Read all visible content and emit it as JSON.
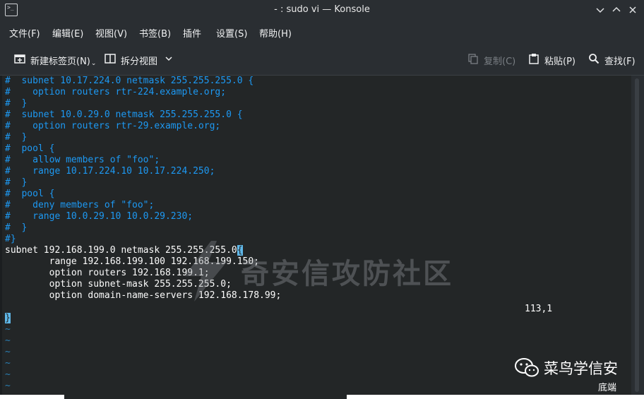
{
  "window": {
    "title": "- : sudo vi — Konsole",
    "app_icon": "terminal-icon",
    "app_icon_glyph": ">_"
  },
  "menubar": {
    "items": [
      {
        "label": "文件(F)"
      },
      {
        "label": "编辑(E)"
      },
      {
        "label": "视图(V)"
      },
      {
        "label": "书签(B)"
      },
      {
        "label": "插件"
      },
      {
        "label": "设置(S)"
      },
      {
        "label": "帮助(H)"
      }
    ]
  },
  "toolbar": {
    "new_tab_label": "新建标签页(N)",
    "split_view_label": "拆分视图",
    "copy_label": "复制(C)",
    "paste_label": "粘贴(P)",
    "find_label": "查找(F)"
  },
  "terminal": {
    "lines": [
      {
        "text": "#  subnet 10.17.224.0 netmask 255.255.255.0 {",
        "kind": "comment"
      },
      {
        "text": "#    option routers rtr-224.example.org;",
        "kind": "comment"
      },
      {
        "text": "#  }",
        "kind": "comment"
      },
      {
        "text": "#  subnet 10.0.29.0 netmask 255.255.255.0 {",
        "kind": "comment"
      },
      {
        "text": "#    option routers rtr-29.example.org;",
        "kind": "comment"
      },
      {
        "text": "#  }",
        "kind": "comment"
      },
      {
        "text": "#  pool {",
        "kind": "comment"
      },
      {
        "text": "#    allow members of \"foo\";",
        "kind": "comment"
      },
      {
        "text": "#    range 10.17.224.10 10.17.224.250;",
        "kind": "comment"
      },
      {
        "text": "#  }",
        "kind": "comment"
      },
      {
        "text": "#  pool {",
        "kind": "comment"
      },
      {
        "text": "#    deny members of \"foo\";",
        "kind": "comment"
      },
      {
        "text": "#    range 10.0.29.10 10.0.29.230;",
        "kind": "comment"
      },
      {
        "text": "#  }",
        "kind": "comment"
      },
      {
        "text": "#}",
        "kind": "comment"
      },
      {
        "text": "subnet 192.168.199.0 netmask 255.255.255.0",
        "cursor": "{",
        "kind": "code"
      },
      {
        "text": "        range 192.168.199.100 192.168.199.150;",
        "kind": "code"
      },
      {
        "text": "        option routers 192.168.199.1;",
        "kind": "code"
      },
      {
        "text": "        option subnet-mask 255.255.255.0;",
        "kind": "code"
      },
      {
        "text": "        option domain-name-servers 192.168.178.99;",
        "kind": "code"
      },
      {
        "text": "",
        "kind": "code"
      },
      {
        "text": "",
        "cursor": "}",
        "kind": "code"
      },
      {
        "text": "~",
        "kind": "tilde"
      },
      {
        "text": "~",
        "kind": "tilde"
      },
      {
        "text": "~",
        "kind": "tilde"
      },
      {
        "text": "~",
        "kind": "tilde"
      },
      {
        "text": "~",
        "kind": "tilde"
      },
      {
        "text": "~",
        "kind": "tilde"
      }
    ],
    "status_position": "113,1"
  },
  "watermark": {
    "text": "奇安信攻防社区"
  },
  "badge": {
    "name": "菜鸟学信安",
    "suffix": "底端"
  },
  "colors": {
    "comment": "#1d99f3",
    "text": "#fcfcfc",
    "background": "#232627",
    "chrome": "#2a2e32",
    "cursor": "#5fb7e8"
  }
}
